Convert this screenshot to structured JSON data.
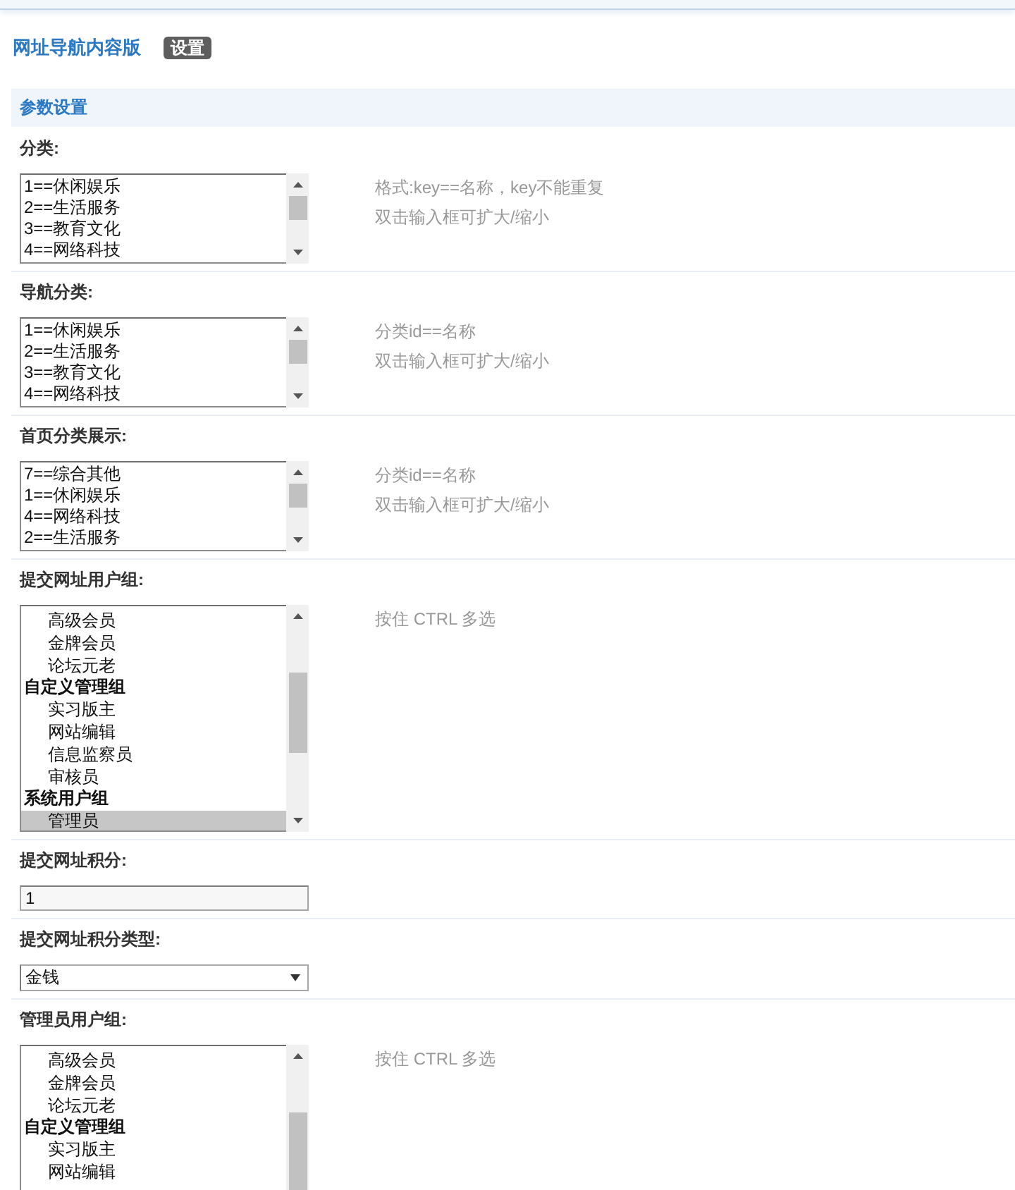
{
  "header": {
    "title": "网址导航内容版",
    "badge": "设置"
  },
  "section": {
    "title": "参数设置"
  },
  "settings": [
    {
      "kind": "textarea",
      "label": "分类:",
      "lines": [
        "1==休闲娱乐",
        "2==生活服务",
        "3==教育文化",
        "4==网络科技"
      ],
      "hints": [
        "格式:key==名称，key不能重复",
        "双击输入框可扩大/缩小"
      ]
    },
    {
      "kind": "textarea",
      "label": "导航分类:",
      "lines": [
        "1==休闲娱乐",
        "2==生活服务",
        "3==教育文化",
        "4==网络科技"
      ],
      "hints": [
        "分类id==名称",
        "双击输入框可扩大/缩小"
      ]
    },
    {
      "kind": "textarea",
      "label": "首页分类展示:",
      "lines": [
        "7==综合其他",
        "1==休闲娱乐",
        "4==网络科技",
        "2==生活服务"
      ],
      "hints": [
        "分类id==名称",
        "双击输入框可扩大/缩小"
      ]
    },
    {
      "kind": "listbox",
      "label": "提交网址用户组:",
      "items": [
        {
          "kind": "option",
          "text": "高级会员",
          "selected": false
        },
        {
          "kind": "option",
          "text": "金牌会员",
          "selected": false
        },
        {
          "kind": "option",
          "text": "论坛元老",
          "selected": false
        },
        {
          "kind": "group",
          "text": "自定义管理组"
        },
        {
          "kind": "option",
          "text": "实习版主",
          "selected": false
        },
        {
          "kind": "option",
          "text": "网站编辑",
          "selected": false
        },
        {
          "kind": "option",
          "text": "信息监察员",
          "selected": false
        },
        {
          "kind": "option",
          "text": "审核员",
          "selected": false
        },
        {
          "kind": "group",
          "text": "系统用户组"
        },
        {
          "kind": "option",
          "text": "管理员",
          "selected": true
        }
      ],
      "hints": [
        "按住 CTRL 多选"
      ]
    },
    {
      "kind": "input",
      "label": "提交网址积分:",
      "value": "1"
    },
    {
      "kind": "select",
      "label": "提交网址积分类型:",
      "value": "金钱"
    },
    {
      "kind": "listbox",
      "label": "管理员用户组:",
      "items": [
        {
          "kind": "option",
          "text": "高级会员",
          "selected": false
        },
        {
          "kind": "option",
          "text": "金牌会员",
          "selected": false
        },
        {
          "kind": "option",
          "text": "论坛元老",
          "selected": false
        },
        {
          "kind": "group",
          "text": "自定义管理组"
        },
        {
          "kind": "option",
          "text": "实习版主",
          "selected": false
        },
        {
          "kind": "option",
          "text": "网站编辑",
          "selected": false
        }
      ],
      "hints": [
        "按住 CTRL 多选"
      ]
    }
  ]
}
